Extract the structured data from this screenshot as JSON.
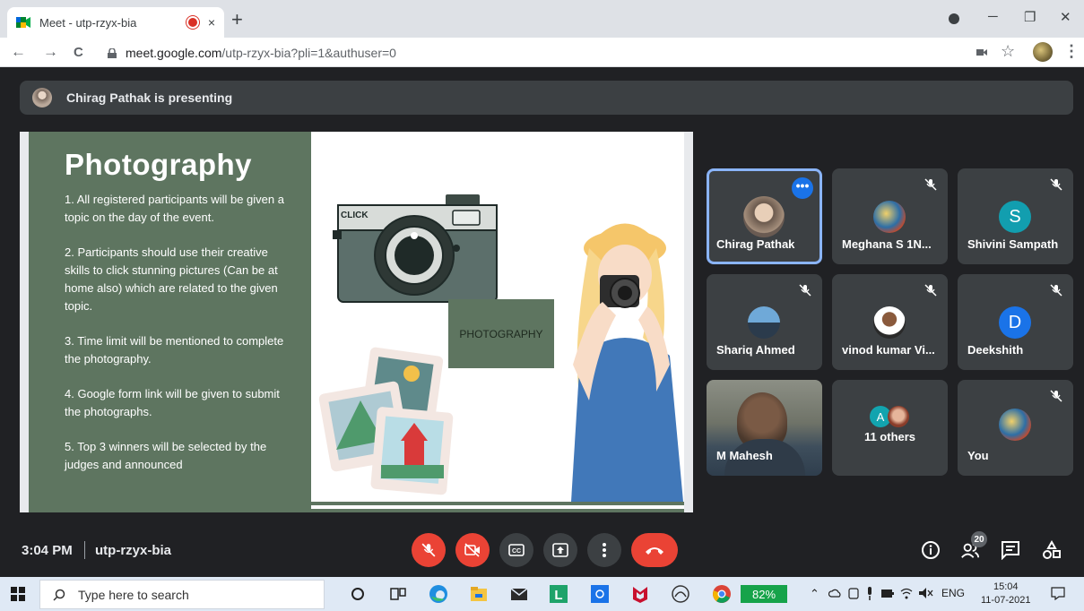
{
  "browser": {
    "tab_title": "Meet - utp-rzyx-bia",
    "tab_close": "×",
    "new_tab": "+",
    "url_host": "meet.google.com",
    "url_path": "/utp-rzyx-bia?pli=1&authuser=0",
    "back": "←",
    "forward": "→",
    "reload": "C",
    "minimize": "─",
    "restore": "❐",
    "close": "✕",
    "menu": "⋮",
    "star": "☆"
  },
  "presentation": {
    "banner": "Chirag Pathak is presenting"
  },
  "slide": {
    "title": "Photography",
    "points": [
      "1. All registered participants will be given a topic on the day of the event.",
      "2. Participants should use their creative skills to click stunning pictures (Can be at home also) which are related to the given topic.",
      "3. Time limit will be mentioned to complete the photography.",
      "4. Google form link will be given to submit the photographs.",
      "5. Top 3 winners will be selected by the judges and announced"
    ],
    "camera_label": "CLICK",
    "box_label": "PHOTOGRAPHY"
  },
  "participants": [
    {
      "name": "Chirag Pathak",
      "muted": false,
      "active": true
    },
    {
      "name": "Meghana S 1N...",
      "muted": true
    },
    {
      "name": "Shivini Sampath",
      "muted": true,
      "initial": "S",
      "color": "#129eaf"
    },
    {
      "name": "Shariq Ahmed",
      "muted": true
    },
    {
      "name": "vinod kumar Vi...",
      "muted": true
    },
    {
      "name": "Deekshith",
      "muted": true,
      "initial": "D",
      "color": "#1a73e8"
    },
    {
      "name": "M Mahesh",
      "muted": false,
      "video": true
    },
    {
      "name": "11 others",
      "initial": "A",
      "color": "#12a4af"
    },
    {
      "name": "You",
      "muted": true
    }
  ],
  "controls": {
    "time": "3:04 PM",
    "meeting_code": "utp-rzyx-bia",
    "people_count": "20"
  },
  "taskbar": {
    "search_placeholder": "Type here to search",
    "battery": "82%",
    "language": "ENG",
    "time": "15:04",
    "date": "11-07-2021"
  }
}
